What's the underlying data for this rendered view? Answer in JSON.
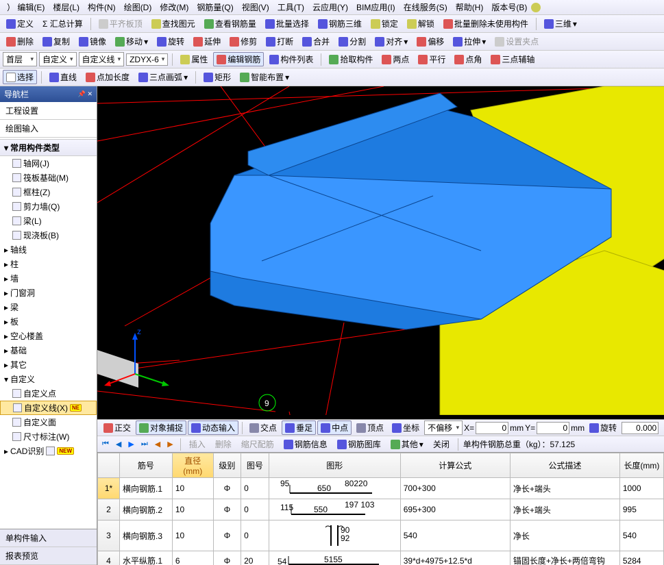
{
  "menu": [
    "） 编辑(E)",
    "楼层(L)",
    "构件(N)",
    "绘图(D)",
    "修改(M)",
    "钢筋量(Q)",
    "视图(V)",
    "工具(T)",
    "云应用(Y)",
    "BIM应用(I)",
    "在线服务(S)",
    "帮助(H)",
    "版本号(B)"
  ],
  "tb1": {
    "dingyi": "定义",
    "huizong": "Σ 汇总计算",
    "pingqi": "平齐板顶",
    "chayuan": "查找图元",
    "chagangjin": "查看钢筋量",
    "piliang": "批量选择",
    "gangjin3d": "钢筋三维",
    "suoding": "锁定",
    "jiesuo": "解锁",
    "piliangdel": "批量删除未使用构件",
    "sanwei": "三维"
  },
  "tb2": {
    "del": "删除",
    "copy": "复制",
    "mirror": "镜像",
    "move": "移动",
    "rotate": "旋转",
    "extend": "延伸",
    "xiujian": "修剪",
    "daduan": "打断",
    "hebing": "合并",
    "fenge": "分割",
    "duiqi": "对齐",
    "pianyi": "偏移",
    "lashen": "拉伸",
    "shezhi": "设置夹点"
  },
  "tb3": {
    "floor": "首层",
    "a": "自定义",
    "b": "自定义线",
    "c": "ZDYX-6",
    "shuxing": "属性",
    "editgj": "编辑钢筋",
    "gjlb": "构件列表",
    "shiqu": "拾取构件",
    "liangdian": "两点",
    "pingxing": "平行",
    "dianjiao": "点角",
    "sandian": "三点辅轴"
  },
  "tb4": {
    "xuanze": "选择",
    "zhixian": "直线",
    "dianjia": "点加长度",
    "sandianhu": "三点画弧",
    "juxing": "矩形",
    "zhineng": "智能布置"
  },
  "side": {
    "title": "导航栏",
    "tabs": [
      "工程设置",
      "绘图输入"
    ],
    "h1": "常用构件类型",
    "items1": [
      "轴网(J)",
      "筏板基础(M)",
      "框柱(Z)",
      "剪力墙(Q)",
      "梁(L)",
      "现浇板(B)"
    ],
    "items2": [
      "轴线",
      "柱",
      "墙",
      "门窗洞",
      "梁",
      "板",
      "空心楼盖",
      "基础",
      "其它",
      "自定义"
    ],
    "sub": [
      "自定义点",
      "自定义线(X)",
      "自定义面",
      "尺寸标注(W)"
    ],
    "cad": "CAD识别",
    "btabs": [
      "单构件输入",
      "报表预览"
    ]
  },
  "status": {
    "zhengjiao": "正交",
    "duixiang": "对象捕捉",
    "dongtai": "动态输入",
    "jiaodian": "交点",
    "chuizu": "垂足",
    "zhongdian": "中点",
    "dingdian": "顶点",
    "zuobiao": "坐标",
    "bupianyi": "不偏移",
    "xlabel": "X=",
    "xval": "0",
    "xunit": "mm",
    "ylabel": "Y=",
    "yval": "0",
    "yunit": "mm",
    "xuanzhuan": "旋转",
    "rval": "0.000"
  },
  "sub2": {
    "charu": "插入",
    "del": "删除",
    "suochi": "缩尺配筋",
    "gangjinxin": "钢筋信息",
    "gangjintuku": "钢筋图库",
    "qita": "其他",
    "guanbi": "关闭",
    "zongzhong": "单构件钢筋总重（kg）：57.125"
  },
  "grid": {
    "headers": [
      "",
      "筋号",
      "直径(mm)",
      "级别",
      "图号",
      "图形",
      "计算公式",
      "公式描述",
      "长度(mm)"
    ],
    "rows": [
      {
        "n": "1*",
        "jin": "横向钢筋.1",
        "d": "10",
        "lv": "Φ",
        "tu": "0",
        "shape": "line650",
        "gs": "700+300",
        "ms": "净长+端头",
        "len": "1000"
      },
      {
        "n": "2",
        "jin": "横向钢筋.2",
        "d": "10",
        "lv": "Φ",
        "tu": "0",
        "shape": "line550",
        "gs": "695+300",
        "ms": "净长+端头",
        "len": "995"
      },
      {
        "n": "3",
        "jin": "横向钢筋.3",
        "d": "10",
        "lv": "Φ",
        "tu": "0",
        "shape": "hook",
        "gs": "540",
        "ms": "净长",
        "len": "540"
      },
      {
        "n": "4",
        "jin": "水平纵筋.1",
        "d": "6",
        "lv": "Φ",
        "tu": "20",
        "shape": "l5155",
        "gs": "39*d+4975+12.5*d",
        "ms": "锚固长度+净长+两倍弯钩",
        "len": "5284"
      }
    ],
    "shape_labels": {
      "s1a": "95",
      "s1b": "650",
      "s1c": "80220",
      "s2a": "115",
      "s2b": "550",
      "s2c": "197 103",
      "s3a": "90",
      "s3b": "92",
      "s4a": "54",
      "s4b": "5155"
    }
  },
  "axis_num": "9"
}
